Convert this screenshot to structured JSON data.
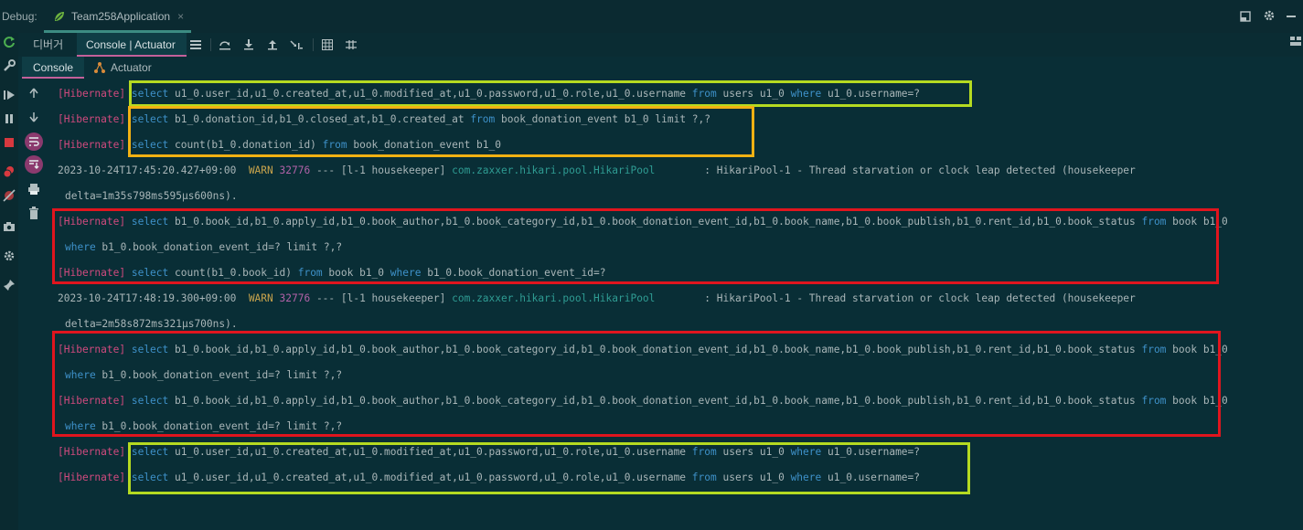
{
  "header": {
    "debug_label": "Debug:",
    "run_tab": "Team258Application",
    "close_glyph": "×"
  },
  "toolbar": {
    "debugger_tab": "디버거",
    "console_actuator_tab": "Console | Actuator"
  },
  "subtabs": {
    "console": "Console",
    "actuator": "Actuator"
  },
  "log": [
    {
      "segments": [
        [
          "hib",
          "[Hibernate]"
        ],
        [
          "t",
          " "
        ],
        [
          "kw",
          "select"
        ],
        [
          "t",
          " u1_0.user_id,u1_0.created_at,u1_0.modified_at,u1_0.password,u1_0.role,u1_0.username "
        ],
        [
          "kw",
          "from"
        ],
        [
          "t",
          " users u1_0 "
        ],
        [
          "kw",
          "where"
        ],
        [
          "t",
          " u1_0.username=?"
        ]
      ]
    },
    {
      "segments": [
        [
          "hib",
          "[Hibernate]"
        ],
        [
          "t",
          " "
        ],
        [
          "kw",
          "select"
        ],
        [
          "t",
          " b1_0.donation_id,b1_0.closed_at,b1_0.created_at "
        ],
        [
          "kw",
          "from"
        ],
        [
          "t",
          " book_donation_event b1_0 limit ?,?"
        ]
      ]
    },
    {
      "segments": [
        [
          "hib",
          "[Hibernate]"
        ],
        [
          "t",
          " "
        ],
        [
          "kw",
          "select"
        ],
        [
          "t",
          " count(b1_0.donation_id) "
        ],
        [
          "kw",
          "from"
        ],
        [
          "t",
          " book_donation_event b1_0"
        ]
      ]
    },
    {
      "segments": [
        [
          "t",
          "2023-10-24T17:45:20.427+09:00  "
        ],
        [
          "warn",
          "WARN"
        ],
        [
          "t",
          " "
        ],
        [
          "pid",
          "32776"
        ],
        [
          "t",
          " --- [l-1 housekeeper] "
        ],
        [
          "cls",
          "com.zaxxer.hikari.pool.HikariPool"
        ],
        [
          "t",
          "        : HikariPool-1 - Thread starvation or clock leap detected (housekeeper"
        ]
      ]
    },
    {
      "cont": true,
      "segments": [
        [
          "t",
          "delta=1m35s798ms595µs600ns)."
        ]
      ]
    },
    {
      "segments": [
        [
          "hib",
          "[Hibernate]"
        ],
        [
          "t",
          " "
        ],
        [
          "kw",
          "select"
        ],
        [
          "t",
          " b1_0.book_id,b1_0.apply_id,b1_0.book_author,b1_0.book_category_id,b1_0.book_donation_event_id,b1_0.book_name,b1_0.book_publish,b1_0.rent_id,b1_0.book_status "
        ],
        [
          "kw",
          "from"
        ],
        [
          "t",
          " book b1_0"
        ]
      ]
    },
    {
      "cont": true,
      "segments": [
        [
          "kw",
          "where"
        ],
        [
          "t",
          " b1_0.book_donation_event_id=? limit ?,?"
        ]
      ]
    },
    {
      "segments": [
        [
          "hib",
          "[Hibernate]"
        ],
        [
          "t",
          " "
        ],
        [
          "kw",
          "select"
        ],
        [
          "t",
          " count(b1_0.book_id) "
        ],
        [
          "kw",
          "from"
        ],
        [
          "t",
          " book b1_0 "
        ],
        [
          "kw",
          "where"
        ],
        [
          "t",
          " b1_0.book_donation_event_id=?"
        ]
      ]
    },
    {
      "segments": [
        [
          "t",
          "2023-10-24T17:48:19.300+09:00  "
        ],
        [
          "warn",
          "WARN"
        ],
        [
          "t",
          " "
        ],
        [
          "pid",
          "32776"
        ],
        [
          "t",
          " --- [l-1 housekeeper] "
        ],
        [
          "cls",
          "com.zaxxer.hikari.pool.HikariPool"
        ],
        [
          "t",
          "        : HikariPool-1 - Thread starvation or clock leap detected (housekeeper"
        ]
      ]
    },
    {
      "cont": true,
      "segments": [
        [
          "t",
          "delta=2m58s872ms321µs700ns)."
        ]
      ]
    },
    {
      "segments": [
        [
          "hib",
          "[Hibernate]"
        ],
        [
          "t",
          " "
        ],
        [
          "kw",
          "select"
        ],
        [
          "t",
          " b1_0.book_id,b1_0.apply_id,b1_0.book_author,b1_0.book_category_id,b1_0.book_donation_event_id,b1_0.book_name,b1_0.book_publish,b1_0.rent_id,b1_0.book_status "
        ],
        [
          "kw",
          "from"
        ],
        [
          "t",
          " book b1_0"
        ]
      ]
    },
    {
      "cont": true,
      "segments": [
        [
          "kw",
          "where"
        ],
        [
          "t",
          " b1_0.book_donation_event_id=? limit ?,?"
        ]
      ]
    },
    {
      "segments": [
        [
          "hib",
          "[Hibernate]"
        ],
        [
          "t",
          " "
        ],
        [
          "kw",
          "select"
        ],
        [
          "t",
          " b1_0.book_id,b1_0.apply_id,b1_0.book_author,b1_0.book_category_id,b1_0.book_donation_event_id,b1_0.book_name,b1_0.book_publish,b1_0.rent_id,b1_0.book_status "
        ],
        [
          "kw",
          "from"
        ],
        [
          "t",
          " book b1_0"
        ]
      ]
    },
    {
      "cont": true,
      "segments": [
        [
          "kw",
          "where"
        ],
        [
          "t",
          " b1_0.book_donation_event_id=? limit ?,?"
        ]
      ]
    },
    {
      "segments": [
        [
          "hib",
          "[Hibernate]"
        ],
        [
          "t",
          " "
        ],
        [
          "kw",
          "select"
        ],
        [
          "t",
          " u1_0.user_id,u1_0.created_at,u1_0.modified_at,u1_0.password,u1_0.role,u1_0.username "
        ],
        [
          "kw",
          "from"
        ],
        [
          "t",
          " users u1_0 "
        ],
        [
          "kw",
          "where"
        ],
        [
          "t",
          " u1_0.username=?"
        ]
      ]
    },
    {
      "segments": [
        [
          "hib",
          "[Hibernate]"
        ],
        [
          "t",
          " "
        ],
        [
          "kw",
          "select"
        ],
        [
          "t",
          " u1_0.user_id,u1_0.created_at,u1_0.modified_at,u1_0.password,u1_0.role,u1_0.username "
        ],
        [
          "kw",
          "from"
        ],
        [
          "t",
          " users u1_0 "
        ],
        [
          "kw",
          "where"
        ],
        [
          "t",
          " u1_0.username=?"
        ]
      ]
    }
  ],
  "highlight_boxes": [
    {
      "name": "user-query-box-1",
      "color": "#B5DA21"
    },
    {
      "name": "donation-event-box",
      "color": "#F2B113"
    },
    {
      "name": "book-query-box-1",
      "color": "#E0151E"
    },
    {
      "name": "book-query-box-2",
      "color": "#E0151E"
    },
    {
      "name": "user-query-box-2",
      "color": "#B5DA21"
    }
  ],
  "colors": {
    "background": "#092E36",
    "hibernate_tag": "#D04A7E",
    "keyword": "#3E91C9",
    "warn": "#C8A34C"
  }
}
